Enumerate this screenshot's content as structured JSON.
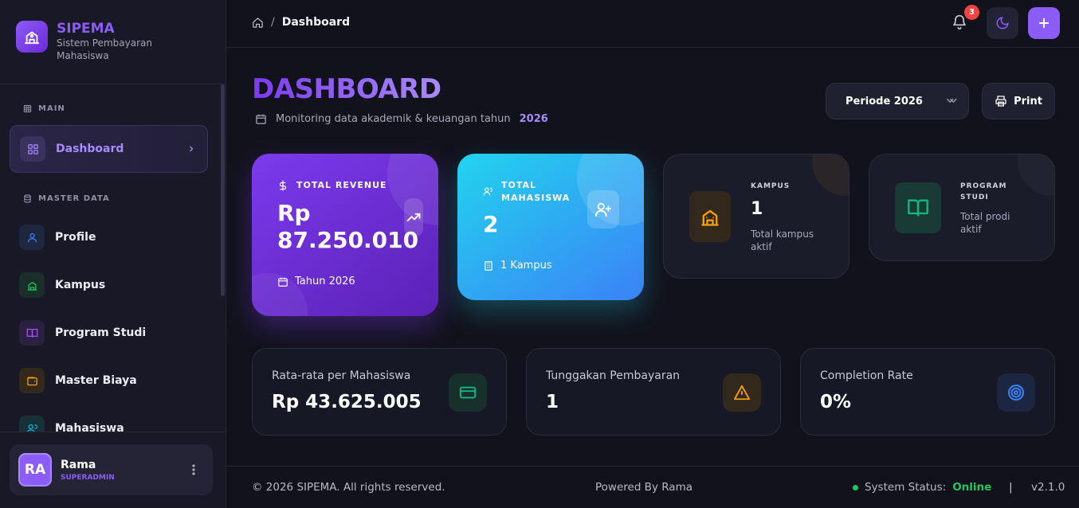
{
  "brand": {
    "name": "SIPEMA",
    "subtitle": "Sistem Pembayaran Mahasiswa",
    "logo_icon": "school-building-icon"
  },
  "sidebar": {
    "sections": [
      {
        "label": "MAIN",
        "icon": "grid-icon"
      },
      {
        "label": "MASTER DATA",
        "icon": "database-icon"
      }
    ],
    "items": [
      {
        "label": "Dashboard",
        "icon": "grid-icon",
        "active": true
      },
      {
        "label": "Profile",
        "icon": "user-icon",
        "color": "#3b82f6"
      },
      {
        "label": "Kampus",
        "icon": "school-icon",
        "color": "#22c55e"
      },
      {
        "label": "Program Studi",
        "icon": "book-open-icon",
        "color": "#a855f7"
      },
      {
        "label": "Master Biaya",
        "icon": "wallet-icon",
        "color": "#f59e0b"
      },
      {
        "label": "Mahasiswa",
        "icon": "users-icon",
        "color": "#06b6d4"
      }
    ]
  },
  "user": {
    "initials": "RA",
    "name": "Rama",
    "role": "SUPERADMIN"
  },
  "topbar": {
    "breadcrumb_current": "Dashboard",
    "breadcrumb_separator": "/",
    "notification_count": "3"
  },
  "header": {
    "title": "DASHBOARD",
    "subtitle": "Monitoring data akademik & keuangan tahun",
    "year": "2026",
    "period_label": "Periode 2026",
    "print_label": "Print"
  },
  "stats": {
    "revenue": {
      "label": "TOTAL REVENUE",
      "value_line1": "Rp",
      "value_line2": "87.250.010",
      "footer": "Tahun 2026"
    },
    "mahasiswa": {
      "label_line1": "TOTAL",
      "label_line2": "MAHASISWA",
      "value": "2",
      "footer": "1 Kampus"
    },
    "kampus": {
      "label": "KAMPUS",
      "value": "1",
      "desc": "Total kampus aktif"
    },
    "prodi": {
      "label_line1": "PROGRAM",
      "label_line2": "STUDI",
      "desc": "Total prodi aktif"
    }
  },
  "summary": [
    {
      "label": "Rata-rata per Mahasiswa",
      "value": "Rp 43.625.005",
      "icon": "credit-card-icon",
      "color": "#10b981"
    },
    {
      "label": "Tunggakan Pembayaran",
      "value": "1",
      "icon": "warning-triangle-icon",
      "color": "#f59e0b"
    },
    {
      "label": "Completion Rate",
      "value": "0%",
      "icon": "target-icon",
      "color": "#3b82f6"
    }
  ],
  "footer": {
    "copyright": "© 2026 SIPEMA. All rights reserved.",
    "powered": "Powered By Rama",
    "status_label": "System Status:",
    "status_value": "Online",
    "separator": "|",
    "version": "v2.1.0"
  },
  "colors": {
    "accent": "#8b5cf6",
    "background": "#12121c",
    "sidebar": "#181826",
    "online": "#22c55e",
    "badge": "#ef4444"
  }
}
